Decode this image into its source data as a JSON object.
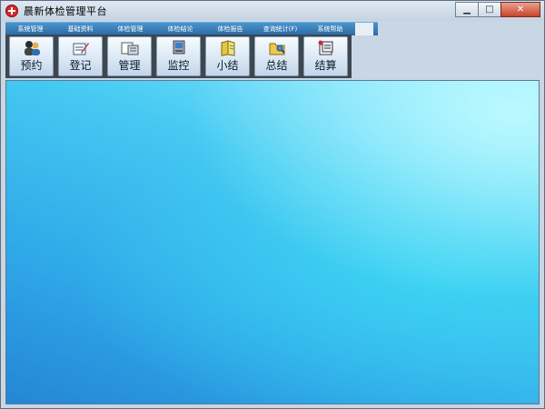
{
  "window": {
    "title": "晨新体检管理平台",
    "colors": {
      "accent": "#2a6aa6",
      "toolbar": "#3e4750"
    }
  },
  "caption": {
    "minimize": "▁",
    "maximize": "□",
    "close": "✕"
  },
  "menu": [
    "系统管理",
    "基础资料",
    "体检管理",
    "体检结论",
    "体检报告",
    "查询统计(F)",
    "系统帮助"
  ],
  "toolbar": [
    {
      "label": "预约",
      "icon": "users-icon"
    },
    {
      "label": "登记",
      "icon": "register-icon"
    },
    {
      "label": "管理",
      "icon": "manage-icon"
    },
    {
      "label": "监控",
      "icon": "monitor-icon"
    },
    {
      "label": "小结",
      "icon": "summary-icon"
    },
    {
      "label": "总结",
      "icon": "conclusion-icon"
    },
    {
      "label": "结算",
      "icon": "settlement-icon"
    }
  ]
}
